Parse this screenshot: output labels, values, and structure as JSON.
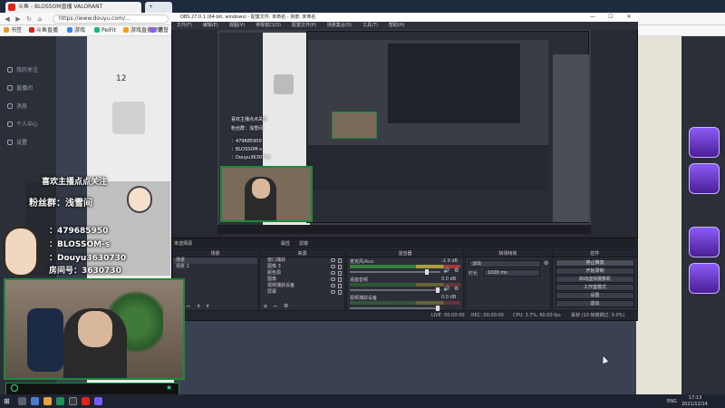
{
  "browser": {
    "tab_title": "斗鱼 - BLOSSOM直播 VALORANT",
    "tab2": "+",
    "address": "https://www.douyu.com/...",
    "bookmarks": [
      "书签",
      "斗鱼直播",
      "游戏",
      "PeiFit",
      "游戏直播频道",
      "荣誉"
    ]
  },
  "site": {
    "nav_items": [
      "我的关注",
      "直播间",
      "消息",
      "个人中心",
      "设置"
    ],
    "view_count": "12"
  },
  "overlay": {
    "welcome": "喜欢主播点点关注",
    "qq_group": "粉丝群：浅雪间",
    "qq": "：479685950",
    "name": "：BLOSSOM-s",
    "douyu": "：Douyu3630730",
    "room": "房间号：3630730"
  },
  "obs": {
    "title": "OBS 27.0.1 (64-bit, windows) - 配置文件: 未命名 - 场景: 未命名",
    "menu": [
      "文件(F)",
      "编辑(E)",
      "视图(V)",
      "停靠窗口(D)",
      "配置文件(P)",
      "场景集合(S)",
      "工具(T)",
      "帮助(H)"
    ],
    "no_source": "未选择源",
    "properties": "属性",
    "filters": "滤镜",
    "docks": {
      "scenes": "场景",
      "sources": "来源",
      "mixer": "混音器",
      "transitions": "转场特效",
      "controls": "控件"
    },
    "scenes": [
      "场景",
      "场景 2"
    ],
    "sources": [
      "窗口捕获",
      "图像 3",
      "颜色源",
      "图像",
      "视频捕获设备",
      "屏幕"
    ],
    "mixer": [
      {
        "name": "麦克风/Aux",
        "db": "-2.9 dB"
      },
      {
        "name": "桌面音频",
        "db": "0.0 dB"
      },
      {
        "name": "视频捕获设备",
        "db": "0.0 dB"
      }
    ],
    "transition": {
      "type": "淡出",
      "duration_label": "时长",
      "duration": "1000 ms"
    },
    "controls": [
      "停止推流",
      "开始录制",
      "启动虚拟摄像机",
      "工作室模式",
      "设置",
      "退出"
    ],
    "status": {
      "live": "LIVE: 00:00:00",
      "rec": "REC: 00:00:00",
      "cpu": "CPU: 3.7%, 60.00 fps",
      "dropped": "丢帧 (10 帧被跳过, 0.0%)"
    }
  },
  "taskbar": {
    "lang": "ENG",
    "time": "17:13",
    "date": "2021/12/14"
  }
}
